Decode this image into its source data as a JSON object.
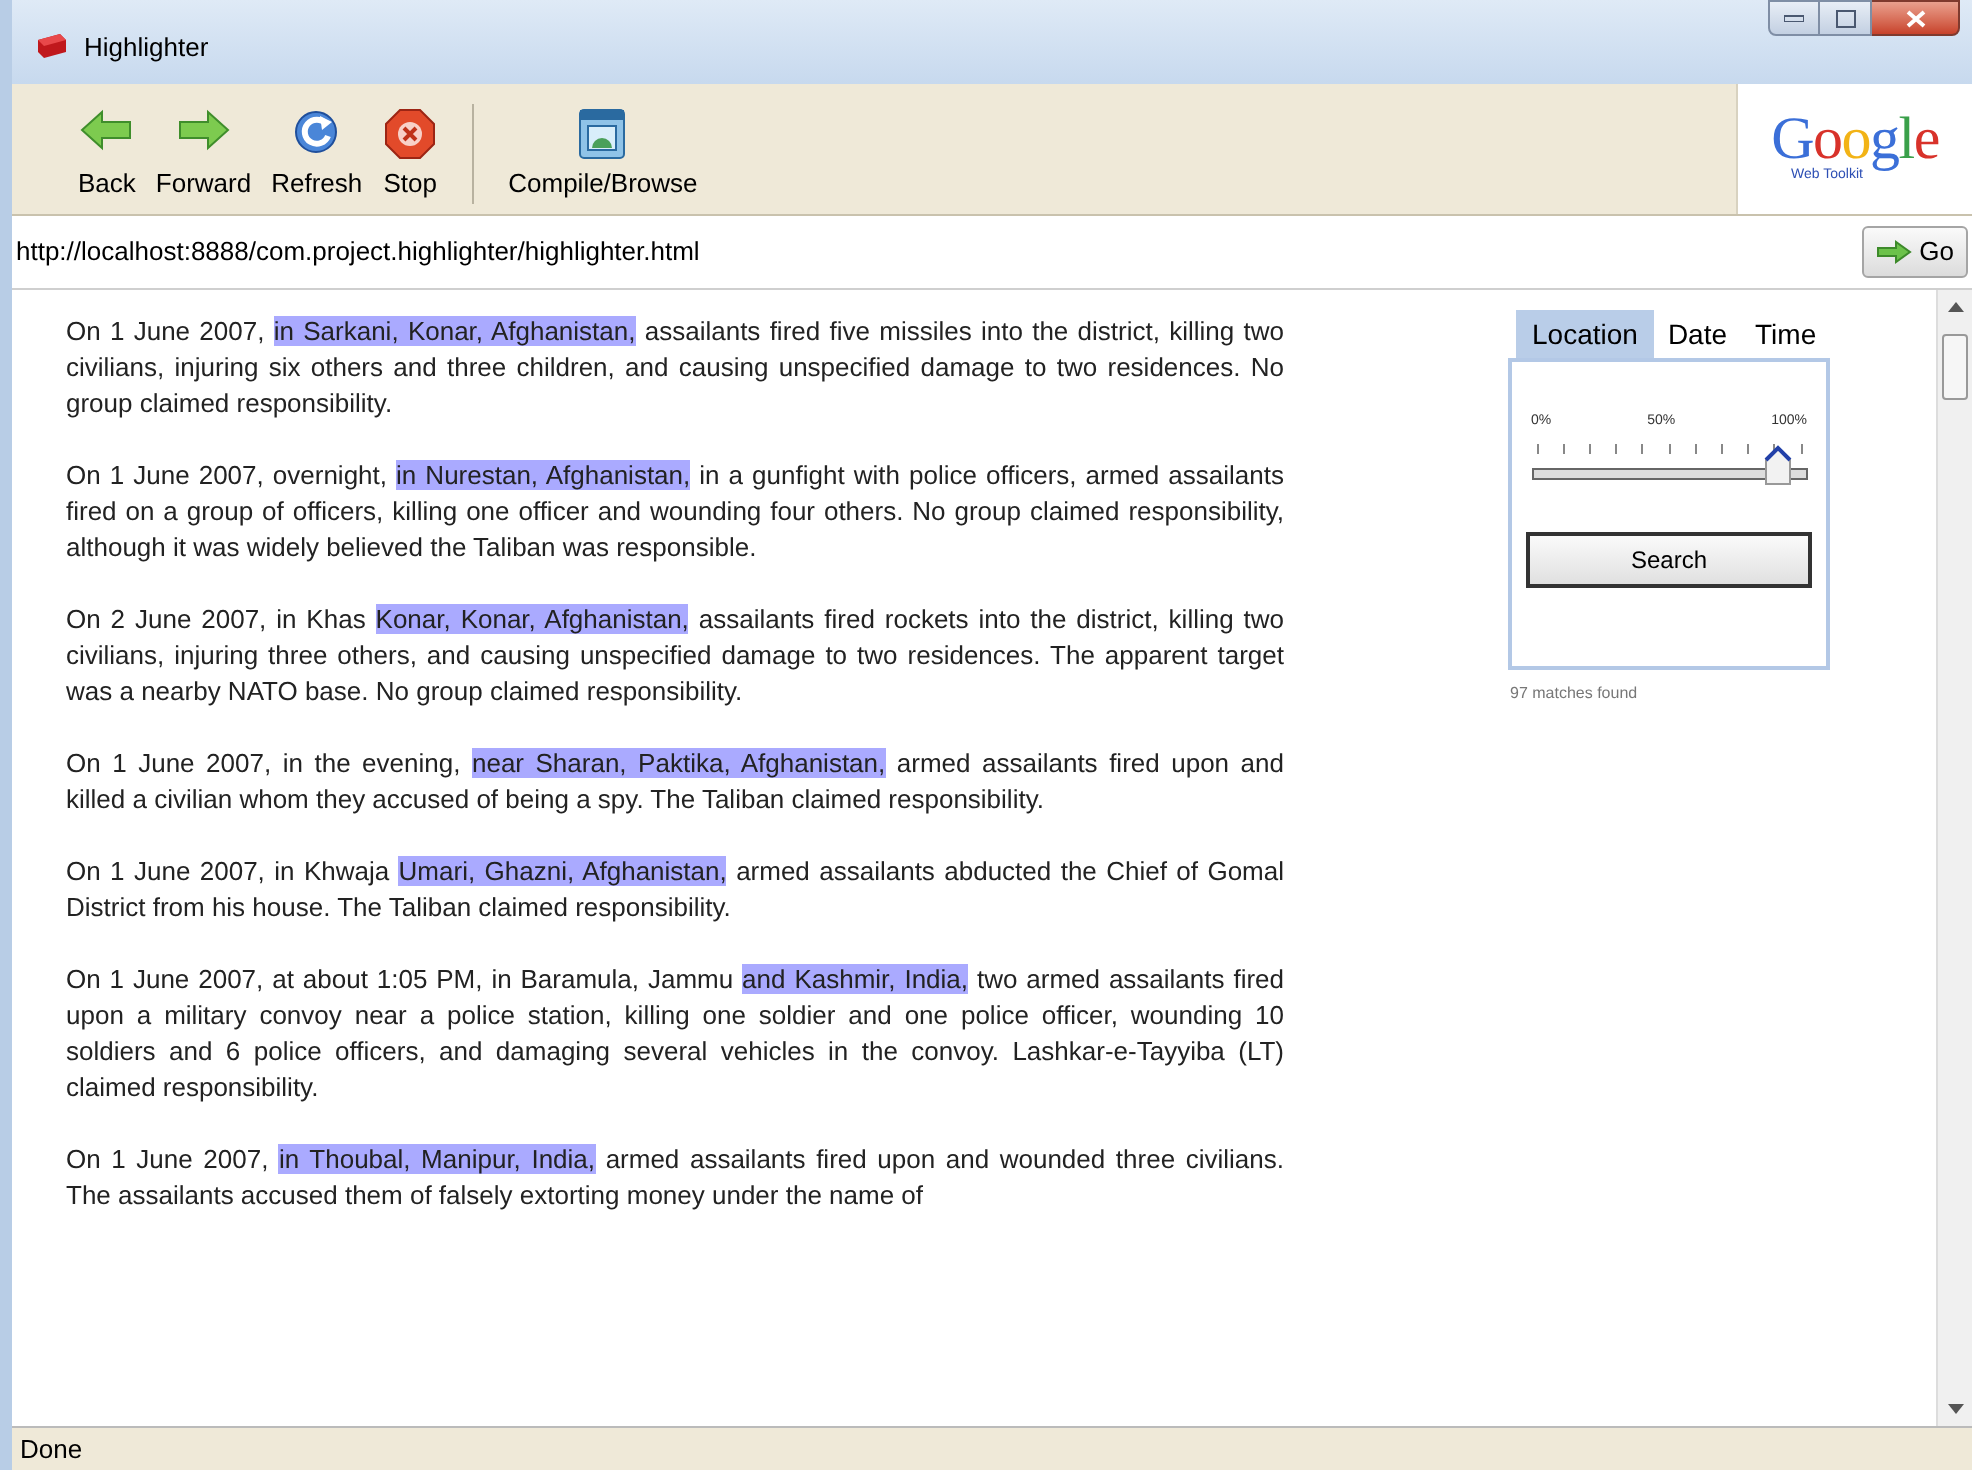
{
  "window": {
    "title": "Highlighter"
  },
  "toolbar": [
    {
      "kind": "back",
      "label": "Back"
    },
    {
      "kind": "forward",
      "label": "Forward"
    },
    {
      "kind": "refresh",
      "label": "Refresh"
    },
    {
      "kind": "stop",
      "label": "Stop"
    },
    {
      "kind": "compile",
      "label": "Compile/Browse"
    }
  ],
  "logo": {
    "name": "Google",
    "subtitle": "Web Toolkit"
  },
  "address_bar": {
    "url": "http://localhost:8888/com.project.highlighter/highlighter.html",
    "go": "Go"
  },
  "paragraphs": [
    {
      "before": "On 1 June 2007, ",
      "highlight": "in Sarkani, Konar, Afghanistan,",
      "after": " assailants fired five missiles into the district, killing two civilians, injuring six others and three children, and causing unspecified damage to two residences. No group claimed responsibility."
    },
    {
      "before": "On 1 June 2007, overnight, ",
      "highlight": "in Nurestan, Afghanistan,",
      "after": " in a gunfight with police officers, armed assailants fired on a group of officers, killing one officer and wounding four others. No group claimed responsibility, although it was widely believed the Taliban was responsible."
    },
    {
      "before": "On 2 June 2007, in Khas ",
      "highlight": "Konar, Konar, Afghanistan,",
      "after": " assailants fired rockets into the district, killing two civilians, injuring three others, and causing unspecified damage to two residences. The apparent target was a nearby NATO base. No group claimed responsibility."
    },
    {
      "before": "On 1 June 2007, in the evening, ",
      "highlight": "near Sharan, Paktika, Afghanistan,",
      "after": " armed assailants fired upon and killed a civilian whom they accused of being a spy. The Taliban claimed responsibility."
    },
    {
      "before": "On 1 June 2007, in Khwaja ",
      "highlight": "Umari, Ghazni, Afghanistan,",
      "after": " armed assailants abducted the Chief of Gomal District from his house. The Taliban claimed responsibility."
    },
    {
      "before": "On 1 June 2007, at about 1:05 PM, in Baramula, Jammu ",
      "highlight": "and Kashmir, India,",
      "after": " two armed assailants fired upon a military convoy near a police station, killing one soldier and one police officer, wounding 10 soldiers and 6 police officers, and damaging several vehicles in the convoy. Lashkar-e-Tayyiba (LT) claimed responsibility."
    },
    {
      "before": "On 1 June 2007, ",
      "highlight": "in Thoubal, Manipur, India,",
      "after": " armed assailants fired upon and wounded three civilians. The assailants accused them of falsely extorting money under the name of"
    }
  ],
  "search_panel": {
    "tabs": [
      {
        "label": "Location",
        "selected": true
      },
      {
        "label": "Date",
        "selected": false
      },
      {
        "label": "Time",
        "selected": false
      }
    ],
    "scale": [
      "0%",
      "50%",
      "100%"
    ],
    "slider": {
      "level": 0.9
    },
    "button": "Search",
    "result": "97 matches found"
  },
  "status_bar": "Done"
}
